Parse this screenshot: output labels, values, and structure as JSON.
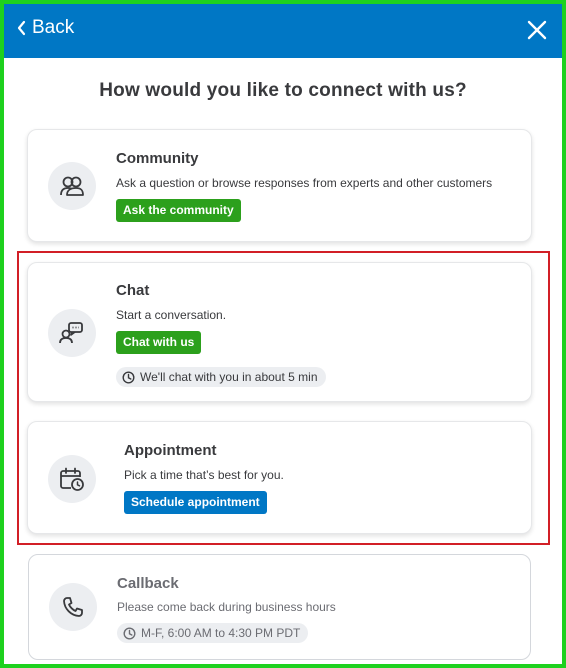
{
  "header": {
    "back_label": "Back",
    "color": "#0077c5"
  },
  "heading": "How would you like to connect with us?",
  "options": {
    "community": {
      "title": "Community",
      "description": "Ask a question or browse responses from experts and other customers",
      "button": "Ask the community",
      "icon": "community-icon"
    },
    "chat": {
      "title": "Chat",
      "description": "Start a conversation.",
      "button": "Chat with us",
      "wait_time": "We'll chat with you in about 5 min",
      "icon": "chat-icon"
    },
    "appointment": {
      "title": "Appointment",
      "description": "Pick a time that’s best for you.",
      "button": "Schedule appointment",
      "icon": "calendar-icon"
    },
    "callback": {
      "title": "Callback",
      "description": "Please come back during business hours",
      "hours": "M-F, 6:00 AM to 4:30 PM PDT",
      "icon": "phone-icon"
    }
  },
  "colors": {
    "primary_green": "#2ca01c",
    "primary_blue": "#0077c5",
    "highlight_red": "#d21f26",
    "frame_green": "#1ed11e"
  }
}
